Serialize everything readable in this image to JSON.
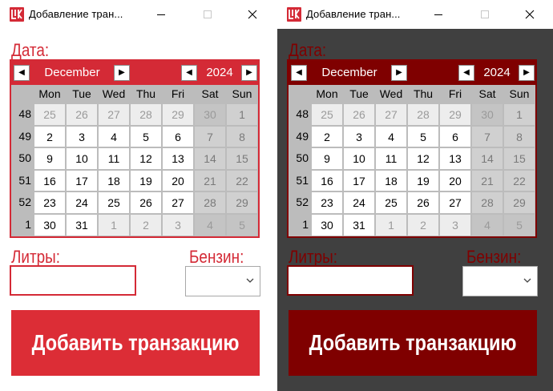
{
  "window": {
    "title": "Добавление тран...",
    "icon": "lukoil-logo-icon"
  },
  "labels": {
    "date": "Дата:",
    "litres": "Литры:",
    "fuel": "Бензин:"
  },
  "calendar": {
    "month": "December",
    "year": "2024",
    "weekdays": [
      "Mon",
      "Tue",
      "Wed",
      "Thu",
      "Fri",
      "Sat",
      "Sun"
    ],
    "weeks": [
      {
        "number": "48",
        "days": [
          "25",
          "26",
          "27",
          "28",
          "29",
          "30",
          "1"
        ],
        "other_month": [
          true,
          true,
          true,
          true,
          true,
          true,
          false
        ]
      },
      {
        "number": "49",
        "days": [
          "2",
          "3",
          "4",
          "5",
          "6",
          "7",
          "8"
        ],
        "other_month": [
          false,
          false,
          false,
          false,
          false,
          false,
          false
        ]
      },
      {
        "number": "50",
        "days": [
          "9",
          "10",
          "11",
          "12",
          "13",
          "14",
          "15"
        ],
        "other_month": [
          false,
          false,
          false,
          false,
          false,
          false,
          false
        ]
      },
      {
        "number": "51",
        "days": [
          "16",
          "17",
          "18",
          "19",
          "20",
          "21",
          "22"
        ],
        "other_month": [
          false,
          false,
          false,
          false,
          false,
          false,
          false
        ]
      },
      {
        "number": "52",
        "days": [
          "23",
          "24",
          "25",
          "26",
          "27",
          "28",
          "29"
        ],
        "other_month": [
          false,
          false,
          false,
          false,
          false,
          false,
          false
        ]
      },
      {
        "number": "1",
        "days": [
          "30",
          "31",
          "1",
          "2",
          "3",
          "4",
          "5"
        ],
        "other_month": [
          false,
          false,
          true,
          true,
          true,
          true,
          true
        ]
      }
    ]
  },
  "litres_input": {
    "value": ""
  },
  "fuel_select": {
    "selected": ""
  },
  "add_button": {
    "label": "Добавить транзакцию"
  },
  "themes": {
    "light": {
      "accent": "#d42a36",
      "background": "#ffffff"
    },
    "dark": {
      "accent": "#7f0000",
      "background": "#404040"
    }
  }
}
